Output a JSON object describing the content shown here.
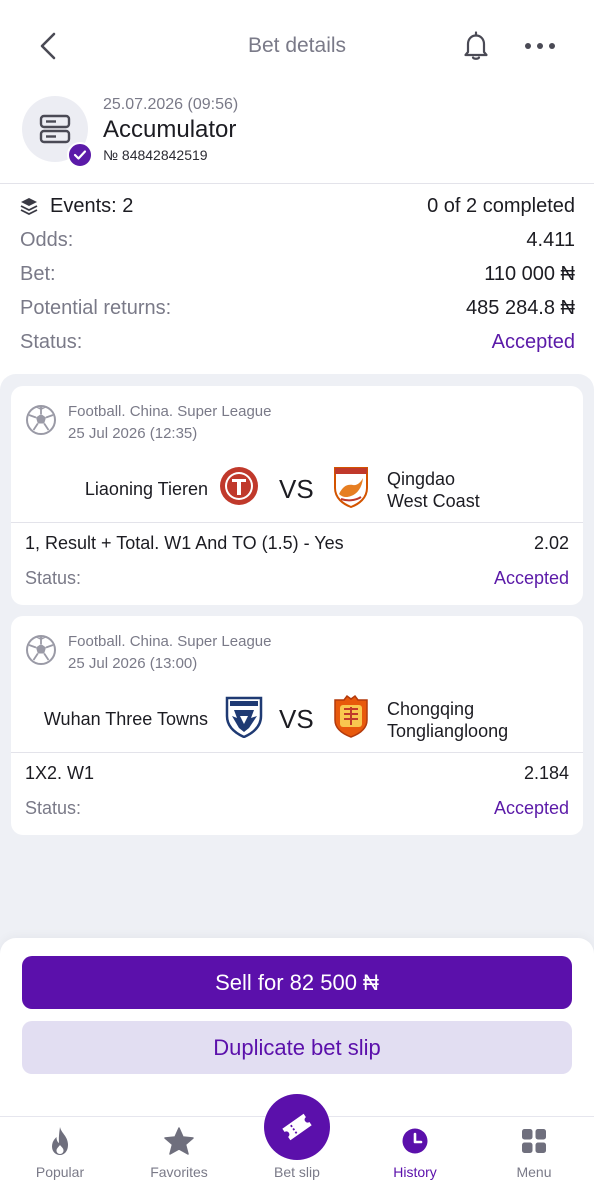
{
  "header": {
    "title": "Bet details"
  },
  "bet": {
    "date": "25.07.2026 (09:56)",
    "type": "Accumulator",
    "number": "№ 84842842519",
    "events_label": "Events: 2",
    "completed": "0 of 2 completed",
    "odds_label": "Odds:",
    "odds_value": "4.411",
    "bet_label": "Bet:",
    "bet_value": "110 000 ₦",
    "returns_label": "Potential returns:",
    "returns_value": "485 284.8 ₦",
    "status_label": "Status:",
    "status_value": "Accepted"
  },
  "events": [
    {
      "league": "Football. China. Super League",
      "date": "25 Jul 2026 (12:35)",
      "team1": "Liaoning Tieren",
      "vs": "VS",
      "team2_line1": "Qingdao",
      "team2_line2": "West Coast",
      "selection": "1, Result + Total. W1 And TO (1.5) - Yes",
      "odds": "2.02",
      "status_label": "Status:",
      "status_value": "Accepted"
    },
    {
      "league": "Football. China. Super League",
      "date": "25 Jul 2026 (13:00)",
      "team1": "Wuhan Three Towns",
      "vs": "VS",
      "team2_line1": "Chongqing",
      "team2_line2": "Tongliangloong",
      "selection": "1X2. W1",
      "odds": "2.184",
      "status_label": "Status:",
      "status_value": "Accepted"
    }
  ],
  "actions": {
    "sell_label": "Sell for 82 500 ₦",
    "duplicate_label": "Duplicate bet slip"
  },
  "tabs": {
    "popular": "Popular",
    "favorites": "Favorites",
    "betslip": "Bet slip",
    "history": "History",
    "menu": "Menu"
  },
  "colors": {
    "accent": "#5b10ab",
    "muted_text": "#7a7a88",
    "background_grey": "#eef0f5"
  },
  "icons": {
    "back": "chevron-left-icon",
    "notifications": "bell-icon",
    "more": "more-dots-icon",
    "bet_type": "accumulator-icon",
    "events": "layers-icon",
    "sport": "football-icon",
    "popular": "flame-icon",
    "favorites": "star-icon",
    "betslip": "ticket-icon",
    "history": "clock-icon",
    "menu": "grid-icon"
  }
}
